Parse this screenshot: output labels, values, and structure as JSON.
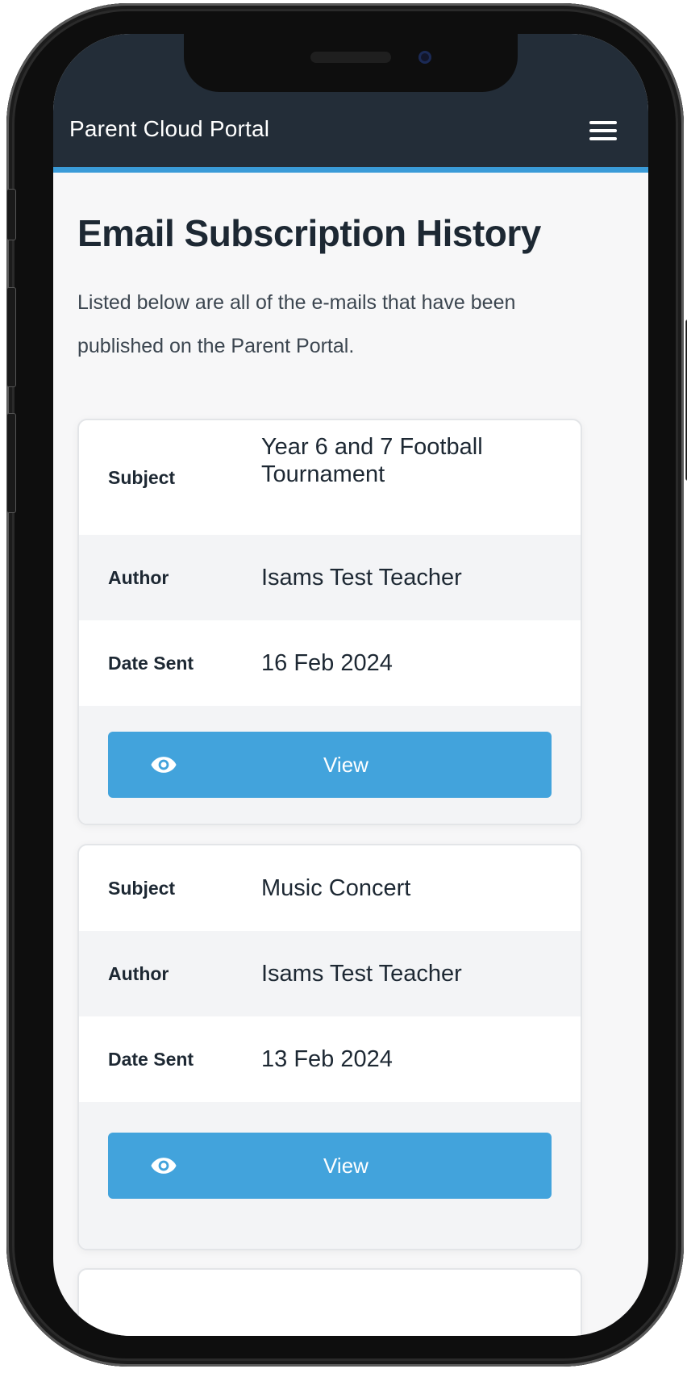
{
  "app": {
    "title": "Parent Cloud Portal"
  },
  "page": {
    "title": "Email Subscription History",
    "intro": "Listed below are all of the e-mails that have been published on the Parent Portal."
  },
  "labels": {
    "subject": "Subject",
    "author": "Author",
    "date_sent": "Date Sent",
    "view": "View"
  },
  "emails": [
    {
      "subject": "Year 6 and 7 Football Tournament",
      "author": "Isams Test Teacher",
      "date_sent": "16 Feb 2024"
    },
    {
      "subject": "Music Concert",
      "author": "Isams Test Teacher",
      "date_sent": "13 Feb 2024"
    }
  ],
  "icons": {
    "menu": "hamburger-menu-icon",
    "view": "eye-icon"
  },
  "colors": {
    "header_bg": "#232d38",
    "accent": "#3a9bd8",
    "button": "#42a3dc"
  }
}
